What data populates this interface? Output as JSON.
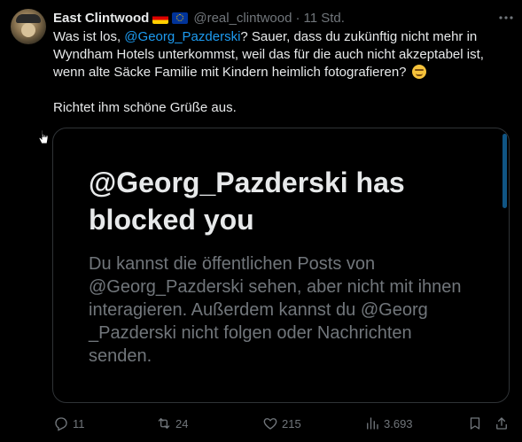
{
  "post": {
    "author_name": "East Clintwood",
    "handle": "@real_clintwood",
    "separator": "·",
    "time": "11 Std.",
    "more_icon": "more-icon",
    "text_part1": "Was ist los, ",
    "mention": "@Georg_Pazderski",
    "text_part2": "? Sauer, dass du zukünftig nicht mehr in Wyndham Hotels unterkommst, weil das für die auch nicht akzeptabel ist, wenn alte Säcke Familie mit Kindern heimlich fotografieren?",
    "text_paragraph2": "Richtet ihm schöne Grüße aus."
  },
  "card": {
    "title": "@Georg_Pazderski has blocked you",
    "body": "Du kannst die öffentlichen Posts von @Georg_Pazderski sehen, aber nicht mit ihnen interagieren. Außerdem kannst du @Georg _Pazderski nicht folgen oder Nachrichten senden."
  },
  "actions": {
    "replies": "11",
    "reposts": "24",
    "likes": "215",
    "views": "3.693"
  },
  "colors": {
    "background": "#000000",
    "text": "#e7e9ea",
    "muted": "#71767b",
    "accent": "#1d9bf0"
  }
}
